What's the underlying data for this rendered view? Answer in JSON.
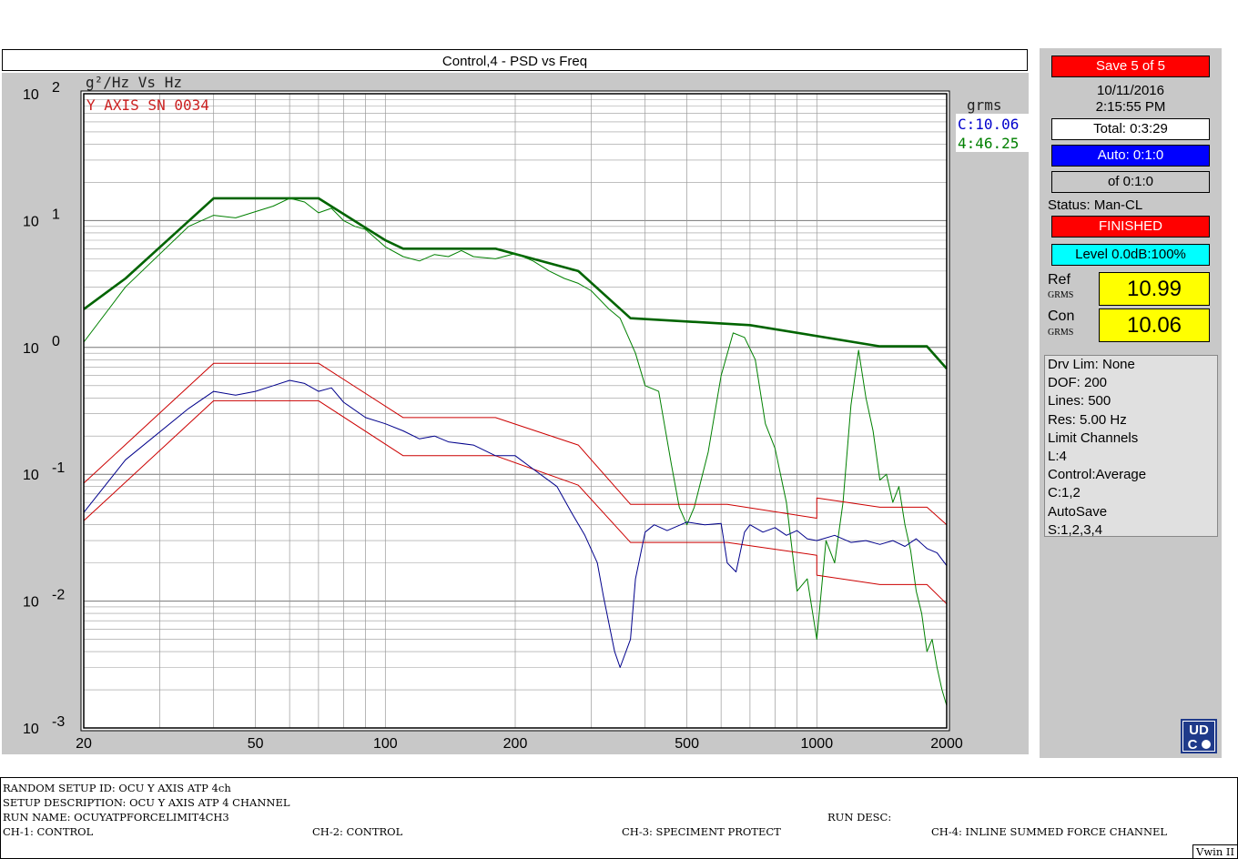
{
  "window": {
    "title": "Control,4 - PSD vs  Freq"
  },
  "chart_data": {
    "type": "line",
    "title": "Control,4 - PSD vs  Freq",
    "ylabel": "g²/Hz Vs Hz",
    "annotation": "Y AXIS SN 0034",
    "x_scale": "log",
    "y_scale": "log",
    "xlim": [
      20,
      2000
    ],
    "ylim": [
      0.001,
      100
    ],
    "x_ticks": [
      {
        "value": 20,
        "label": "20"
      },
      {
        "value": 50,
        "label": "50"
      },
      {
        "value": 100,
        "label": "100"
      },
      {
        "value": 200,
        "label": "200"
      },
      {
        "value": 500,
        "label": "500"
      },
      {
        "value": 1000,
        "label": "1000"
      },
      {
        "value": 2000,
        "label": "2000"
      }
    ],
    "y_ticks": [
      {
        "exp": "2",
        "value": 100
      },
      {
        "exp": "1",
        "value": 10
      },
      {
        "exp": "0",
        "value": 1
      },
      {
        "exp": "-1",
        "value": 0.1
      },
      {
        "exp": "-2",
        "value": 0.01
      },
      {
        "exp": "-3",
        "value": 0.001
      }
    ],
    "grid": true,
    "grms_label": "grms",
    "grms_entries": [
      {
        "text": "C:10.06",
        "color": "#0000cc"
      },
      {
        "text": "4:46.25",
        "color": "#008000"
      }
    ],
    "series": [
      {
        "color": "#006400",
        "width": 2.6,
        "points": [
          [
            20,
            2
          ],
          [
            25,
            3.5
          ],
          [
            40,
            15
          ],
          [
            70,
            15
          ],
          [
            100,
            7
          ],
          [
            110,
            6
          ],
          [
            180,
            6
          ],
          [
            280,
            4
          ],
          [
            370,
            1.7
          ],
          [
            700,
            1.5
          ],
          [
            1400,
            1.02
          ],
          [
            1800,
            1.02
          ],
          [
            2000,
            0.68
          ]
        ]
      },
      {
        "color": "#008000",
        "width": 1,
        "points": [
          [
            20,
            1.1
          ],
          [
            25,
            3.0
          ],
          [
            35,
            9
          ],
          [
            40,
            11
          ],
          [
            45,
            10.5
          ],
          [
            55,
            13
          ],
          [
            60,
            15
          ],
          [
            65,
            14
          ],
          [
            70,
            11.5
          ],
          [
            75,
            12.5
          ],
          [
            80,
            10
          ],
          [
            85,
            9
          ],
          [
            90,
            8.5
          ],
          [
            100,
            6.2
          ],
          [
            110,
            5.2
          ],
          [
            120,
            4.8
          ],
          [
            130,
            5.4
          ],
          [
            140,
            5.2
          ],
          [
            150,
            5.8
          ],
          [
            160,
            5.2
          ],
          [
            180,
            5.0
          ],
          [
            200,
            5.5
          ],
          [
            220,
            4.8
          ],
          [
            240,
            4.0
          ],
          [
            260,
            3.5
          ],
          [
            280,
            3.2
          ],
          [
            300,
            2.8
          ],
          [
            330,
            2.0
          ],
          [
            350,
            1.7
          ],
          [
            380,
            0.9
          ],
          [
            400,
            0.5
          ],
          [
            430,
            0.45
          ],
          [
            460,
            0.12
          ],
          [
            480,
            0.055
          ],
          [
            500,
            0.04
          ],
          [
            520,
            0.055
          ],
          [
            560,
            0.15
          ],
          [
            600,
            0.6
          ],
          [
            640,
            1.3
          ],
          [
            680,
            1.2
          ],
          [
            720,
            0.8
          ],
          [
            760,
            0.25
          ],
          [
            800,
            0.16
          ],
          [
            850,
            0.06
          ],
          [
            900,
            0.012
          ],
          [
            950,
            0.015
          ],
          [
            1000,
            0.005
          ],
          [
            1050,
            0.03
          ],
          [
            1100,
            0.02
          ],
          [
            1150,
            0.06
          ],
          [
            1200,
            0.35
          ],
          [
            1250,
            0.95
          ],
          [
            1300,
            0.4
          ],
          [
            1350,
            0.22
          ],
          [
            1400,
            0.09
          ],
          [
            1450,
            0.1
          ],
          [
            1500,
            0.06
          ],
          [
            1550,
            0.08
          ],
          [
            1600,
            0.04
          ],
          [
            1650,
            0.025
          ],
          [
            1700,
            0.012
          ],
          [
            1750,
            0.008
          ],
          [
            1800,
            0.004
          ],
          [
            1850,
            0.005
          ],
          [
            1900,
            0.003
          ],
          [
            1950,
            0.002
          ],
          [
            2000,
            0.0015
          ]
        ]
      },
      {
        "color": "#cc0000",
        "width": 1,
        "points": [
          [
            20,
            0.085
          ],
          [
            40,
            0.75
          ],
          [
            70,
            0.75
          ],
          [
            110,
            0.28
          ],
          [
            180,
            0.28
          ],
          [
            280,
            0.17
          ],
          [
            370,
            0.058
          ],
          [
            620,
            0.058
          ],
          [
            1000,
            0.045
          ],
          [
            1000,
            0.065
          ],
          [
            1400,
            0.055
          ],
          [
            1800,
            0.055
          ],
          [
            2000,
            0.04
          ]
        ]
      },
      {
        "color": "#cc0000",
        "width": 1,
        "points": [
          [
            20,
            0.043
          ],
          [
            40,
            0.38
          ],
          [
            70,
            0.38
          ],
          [
            110,
            0.14
          ],
          [
            180,
            0.14
          ],
          [
            280,
            0.082
          ],
          [
            370,
            0.029
          ],
          [
            620,
            0.029
          ],
          [
            1000,
            0.023
          ],
          [
            1000,
            0.016
          ],
          [
            1400,
            0.0135
          ],
          [
            1800,
            0.0135
          ],
          [
            2000,
            0.0095
          ]
        ]
      },
      {
        "color": "#00008b",
        "width": 1,
        "points": [
          [
            20,
            0.05
          ],
          [
            25,
            0.13
          ],
          [
            35,
            0.33
          ],
          [
            40,
            0.45
          ],
          [
            45,
            0.42
          ],
          [
            50,
            0.45
          ],
          [
            55,
            0.5
          ],
          [
            60,
            0.55
          ],
          [
            65,
            0.52
          ],
          [
            70,
            0.45
          ],
          [
            75,
            0.48
          ],
          [
            80,
            0.37
          ],
          [
            90,
            0.28
          ],
          [
            100,
            0.25
          ],
          [
            110,
            0.22
          ],
          [
            120,
            0.19
          ],
          [
            130,
            0.2
          ],
          [
            140,
            0.18
          ],
          [
            160,
            0.17
          ],
          [
            180,
            0.14
          ],
          [
            200,
            0.14
          ],
          [
            220,
            0.11
          ],
          [
            250,
            0.08
          ],
          [
            270,
            0.05
          ],
          [
            290,
            0.033
          ],
          [
            310,
            0.02
          ],
          [
            320,
            0.011
          ],
          [
            340,
            0.004
          ],
          [
            350,
            0.003
          ],
          [
            370,
            0.005
          ],
          [
            380,
            0.015
          ],
          [
            400,
            0.035
          ],
          [
            420,
            0.04
          ],
          [
            450,
            0.036
          ],
          [
            500,
            0.042
          ],
          [
            550,
            0.04
          ],
          [
            600,
            0.041
          ],
          [
            620,
            0.02
          ],
          [
            650,
            0.017
          ],
          [
            680,
            0.035
          ],
          [
            700,
            0.04
          ],
          [
            750,
            0.035
          ],
          [
            800,
            0.038
          ],
          [
            850,
            0.033
          ],
          [
            900,
            0.036
          ],
          [
            950,
            0.031
          ],
          [
            1000,
            0.03
          ],
          [
            1100,
            0.033
          ],
          [
            1200,
            0.029
          ],
          [
            1300,
            0.03
          ],
          [
            1400,
            0.028
          ],
          [
            1500,
            0.03
          ],
          [
            1600,
            0.027
          ],
          [
            1700,
            0.031
          ],
          [
            1800,
            0.026
          ],
          [
            1900,
            0.024
          ],
          [
            2000,
            0.019
          ]
        ]
      }
    ]
  },
  "status_panel": {
    "save_label": "Save  5 of  5",
    "date": "10/11/2016",
    "time": "2:15:55 PM",
    "total": "Total: 0:3:29",
    "auto": "Auto: 0:1:0",
    "of": "of 0:1:0",
    "status": "Status: Man-CL",
    "finished": "FINISHED",
    "level": "Level 0.0dB:100%",
    "ref_label": "Ref",
    "ref_unit": "GRMS",
    "ref_value": "10.99",
    "con_label": "Con",
    "con_unit": "GRMS",
    "con_value": "10.06",
    "colors": {
      "red": "#ff0000",
      "blue": "#0000ff",
      "cyan": "#00ffff",
      "yellow": "#ffff00"
    }
  },
  "info": {
    "lines": [
      "Drv Lim: None",
      "DOF: 200",
      "Lines: 500",
      "Res: 5.00 Hz",
      "Limit Channels",
      "L:4",
      "Control:Average",
      "C:1,2",
      "AutoSave",
      "S:1,2,3,4"
    ]
  },
  "logo": {
    "top": "UD",
    "bottom": "C"
  },
  "footer": {
    "setup_id": "RANDOM SETUP ID: OCU Y AXIS ATP 4ch",
    "setup_desc": "SETUP DESCRIPTION: OCU Y AXIS ATP 4 CHANNEL",
    "run_name": "RUN NAME: OCUYATPFORCELIMIT4CH3",
    "run_desc": "RUN DESC:",
    "ch1": "CH-1: CONTROL",
    "ch2": "CH-2: CONTROL",
    "ch3": "CH-3: SPECIMENT PROTECT",
    "ch4": "CH-4: INLINE SUMMED FORCE CHANNEL",
    "vwin": "Vwin II"
  }
}
